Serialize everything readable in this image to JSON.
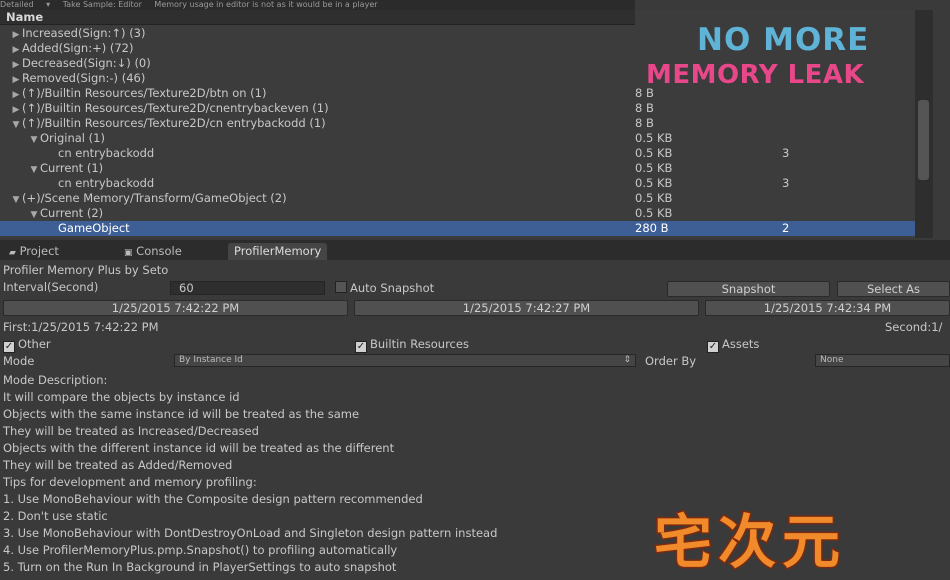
{
  "toolbar": {
    "items": [
      "Detailed",
      "▾",
      "Take Sample: Editor",
      "Memory usage in editor is not as it would be in a player"
    ]
  },
  "tree": {
    "header": "Name",
    "rows": [
      {
        "name": "Increased(Sign:↑) (3)",
        "indent": 0,
        "arrow": "right",
        "size": "",
        "count": ""
      },
      {
        "name": "Added(Sign:+) (72)",
        "indent": 0,
        "arrow": "right",
        "size": "",
        "count": ""
      },
      {
        "name": "Decreased(Sign:↓) (0)",
        "indent": 0,
        "arrow": "right",
        "size": "",
        "count": ""
      },
      {
        "name": "Removed(Sign:-) (46)",
        "indent": 0,
        "arrow": "right",
        "size": "",
        "count": ""
      },
      {
        "name": "(↑)/Builtin Resources/Texture2D/btn on (1)",
        "indent": 0,
        "arrow": "right",
        "size": "8 B",
        "count": ""
      },
      {
        "name": "(↑)/Builtin Resources/Texture2D/cnentrybackeven (1)",
        "indent": 0,
        "arrow": "right",
        "size": "8 B",
        "count": ""
      },
      {
        "name": "(↑)/Builtin Resources/Texture2D/cn entrybackodd (1)",
        "indent": 0,
        "arrow": "down",
        "size": "8 B",
        "count": ""
      },
      {
        "name": "Original (1)",
        "indent": 1,
        "arrow": "down",
        "size": "0.5 KB",
        "count": ""
      },
      {
        "name": "cn entrybackodd",
        "indent": 2,
        "arrow": "",
        "size": "0.5 KB",
        "count": "3"
      },
      {
        "name": "Current (1)",
        "indent": 1,
        "arrow": "down",
        "size": "0.5 KB",
        "count": ""
      },
      {
        "name": "cn entrybackodd",
        "indent": 2,
        "arrow": "",
        "size": "0.5 KB",
        "count": "3"
      },
      {
        "name": "(+)/Scene Memory/Transform/GameObject (2)",
        "indent": 0,
        "arrow": "down",
        "size": "0.5 KB",
        "count": ""
      },
      {
        "name": "Current (2)",
        "indent": 1,
        "arrow": "down",
        "size": "0.5 KB",
        "count": ""
      },
      {
        "name": "GameObject",
        "indent": 2,
        "arrow": "",
        "size": "280 B",
        "count": "2",
        "selected": true
      }
    ]
  },
  "overlay": {
    "line1": "NO MORE",
    "line2": "MEMORY LEAK"
  },
  "tabs": [
    {
      "label": "Project",
      "icon": "folder-icon"
    },
    {
      "label": "Console",
      "icon": "console-icon"
    },
    {
      "label": "ProfilerMemory",
      "icon": "",
      "active": true
    }
  ],
  "panel": {
    "title": "Profiler Memory Plus by Seto",
    "interval_label": "Interval(Second)",
    "interval_value": "60",
    "auto_snapshot_label": "Auto Snapshot",
    "snapshot_button": "Snapshot",
    "select_button": "Select As",
    "snapshots": [
      "1/25/2015 7:42:22 PM",
      "1/25/2015 7:42:27 PM",
      "1/25/2015 7:42:34 PM"
    ],
    "first_label": "First:1/25/2015 7:42:22 PM",
    "second_label": "Second:1/",
    "checks": [
      {
        "label": "Other",
        "checked": true
      },
      {
        "label": "Builtin Resources",
        "checked": true
      },
      {
        "label": "Assets",
        "checked": true
      }
    ],
    "mode_label": "Mode",
    "mode_value": "By Instance Id",
    "order_label": "Order By",
    "order_value": "None",
    "description": [
      "Mode Description:",
      "It will compare the objects by instance id",
      "Objects with the same instance id will be treated as the same",
      "They will be treated as Increased/Decreased",
      "Objects with the different instance id will be treated as the different",
      "They will be treated as Added/Removed",
      "Tips for development and memory profiling:",
      "1. Use MonoBehaviour with the Composite design pattern recommended",
      "2. Don't use static",
      "3. Use MonoBehaviour with DontDestroyOnLoad and Singleton design pattern instead",
      "4. Use ProfilerMemoryPlus.pmp.Snapshot() to profiling automatically",
      "5. Turn on the Run In Background in PlayerSettings to auto snapshot"
    ]
  },
  "logo": {
    "text": "宅次元"
  },
  "colors": {
    "accent_blue": "#5fb3d6",
    "accent_pink": "#e8488a",
    "selection": "#3e5f96"
  }
}
